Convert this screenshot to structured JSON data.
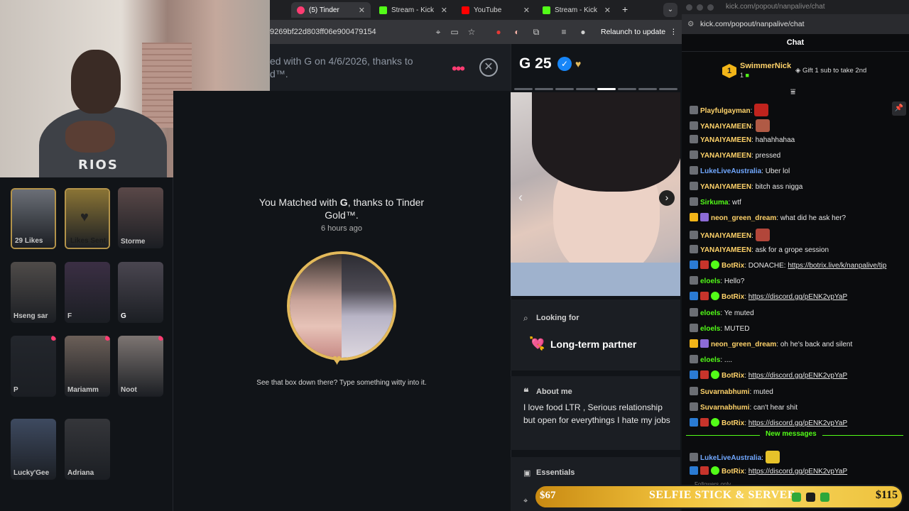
{
  "browser": {
    "tabs": [
      {
        "label": "(5) Tinder",
        "color": "#fe3c72"
      },
      {
        "label": "Stream - Kick",
        "color": "#53fc18"
      },
      {
        "label": "YouTube",
        "color": "#ff0000"
      },
      {
        "label": "Stream - Kick",
        "color": "#53fc18"
      }
    ],
    "new_tab": "+",
    "url": "9269bf22d803ff06e900479154",
    "relaunch_label": "Relaunch to update"
  },
  "webcam": {
    "shirt_text": "RIOS"
  },
  "match_header": {
    "text": "ed with G on 4/6/2026, thanks to d™."
  },
  "matches": [
    {
      "label": "29 Likes",
      "bg": "#6b6f77"
    },
    {
      "label": "Likes Sent",
      "bg": "#8a7435"
    },
    {
      "label": "Storme",
      "bg": "#5a4848"
    },
    {
      "label": "Hseng sar",
      "bg": "#4f4b49"
    },
    {
      "label": "F",
      "bg": "#3b2f44"
    },
    {
      "label": "G",
      "bg": "#4a4650"
    },
    {
      "label": "P",
      "bg": "#23262c"
    },
    {
      "label": "Mariamm",
      "bg": "#6b5f58"
    },
    {
      "label": "Noot",
      "bg": "#7d7572"
    },
    {
      "label": "Lucky'Gee",
      "bg": "#3e4a60"
    },
    {
      "label": "Adriana",
      "bg": "#35363a"
    }
  ],
  "center": {
    "title_pre": "You Matched with ",
    "title_name": "G",
    "title_post": ", thanks to Tinder Gold™.",
    "time": "6 hours ago",
    "hint": "See that box down there? Type something witty into it."
  },
  "profile": {
    "name_age": "G 25",
    "looking_for_label": "Looking for",
    "looking_for_value": "Long-term partner",
    "about_label": "About me",
    "about_text": "I love food LTR , Serious relationship but open for everythings I hate my jobs",
    "essentials_label": "Essentials"
  },
  "chat": {
    "window_url": "kick.com/popout/nanpalive/chat",
    "url": "kick.com/popout/nanpalive/chat",
    "title": "Chat",
    "top_gifter": {
      "badge": "1",
      "name": "SwimmerNick",
      "count": "1"
    },
    "gift_cta": "Gift 1 sub to take 2nd",
    "new_messages": "New messages",
    "followers_note": "Followers only",
    "messages": [
      {
        "user": "Playfulgayman",
        "color": "#ffd36a",
        "text": "",
        "emote": "#c0231d"
      },
      {
        "user": "YANAIYAMEEN",
        "color": "#ffd36a",
        "text": "",
        "emote": "#b05a45"
      },
      {
        "user": "YANAIYAMEEN",
        "color": "#ffd36a",
        "text": "hahahhahaa"
      },
      {
        "user": "YANAIYAMEEN",
        "color": "#ffd36a",
        "text": "pressed"
      },
      {
        "user": "LukeLiveAustralia",
        "color": "#71a8ff",
        "text": "Uber lol"
      },
      {
        "user": "YANAIYAMEEN",
        "color": "#ffd36a",
        "text": "bitch ass nigga"
      },
      {
        "user": "Sirkuma",
        "color": "#53fc18",
        "text": "wtf"
      },
      {
        "user": "neon_green_dream",
        "color": "#ffd36a",
        "text": "what did he ask her?"
      },
      {
        "user": "YANAIYAMEEN",
        "color": "#ffd36a",
        "text": "",
        "emote": "#b2463a"
      },
      {
        "user": "YANAIYAMEEN",
        "color": "#ffd36a",
        "text": "ask for a grope session"
      },
      {
        "user": "BotRix",
        "color": "#ffd36a",
        "text": "DONACHE: ",
        "link": "https://botrix.live/k/nanpalive/tip"
      },
      {
        "user": "eloels",
        "color": "#53fc18",
        "text": "Hello?"
      },
      {
        "user": "BotRix",
        "color": "#ffd36a",
        "text": "",
        "link": "https://discord.gg/pENK2vpYaP"
      },
      {
        "user": "eloels",
        "color": "#53fc18",
        "text": "Ye muted"
      },
      {
        "user": "eloels",
        "color": "#53fc18",
        "text": "MUTED"
      },
      {
        "user": "neon_green_dream",
        "color": "#ffd36a",
        "text": "oh he's back and silent"
      },
      {
        "user": "eloels",
        "color": "#53fc18",
        "text": "...."
      },
      {
        "user": "BotRix",
        "color": "#ffd36a",
        "text": "",
        "link": "https://discord.gg/pENK2vpYaP"
      },
      {
        "user": "Suvarnabhumi",
        "color": "#ffd36a",
        "text": "muted"
      },
      {
        "user": "Suvarnabhumi",
        "color": "#ffd36a",
        "text": "can't hear shit"
      },
      {
        "user": "BotRix",
        "color": "#ffd36a",
        "text": "",
        "link": "https://discord.gg/pENK2vpYaP"
      },
      {
        "user": "LukeLiveAustralia",
        "color": "#71a8ff",
        "text": "",
        "emote": "#e6c22a"
      },
      {
        "user": "BotRix",
        "color": "#ffd36a",
        "text": "",
        "link": "https://discord.gg/pENK2vpYaP"
      }
    ]
  },
  "goal": {
    "left": "$67",
    "title": "SELFIE STICK & SERVER",
    "right": "$115"
  }
}
